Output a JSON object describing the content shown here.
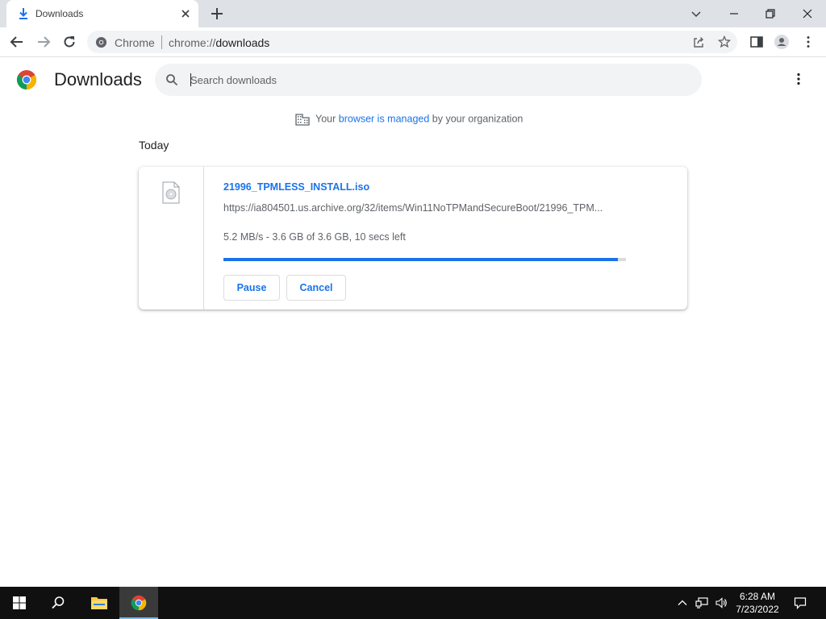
{
  "tab": {
    "title": "Downloads"
  },
  "omnibox": {
    "chip": "Chrome",
    "url_scheme": "chrome://",
    "url_host": "downloads"
  },
  "page": {
    "title": "Downloads",
    "search_placeholder": "Search downloads",
    "managed_prefix": "Your",
    "managed_link": "browser is managed",
    "managed_suffix": "by your organization",
    "date_header": "Today"
  },
  "download": {
    "file_name": "21996_TPMLESS_INSTALL.iso",
    "url": "https://ia804501.us.archive.org/32/items/Win11NoTPMandSecureBoot/21996_TPM...",
    "status": "5.2 MB/s - 3.6 GB of 3.6 GB, 10 secs left",
    "progress_fraction": 0.98,
    "pause_label": "Pause",
    "cancel_label": "Cancel"
  },
  "taskbar": {
    "time": "6:28 AM",
    "date": "7/23/2022"
  },
  "colors": {
    "accent": "#1a73e8",
    "tab_strip": "#dee1e6",
    "taskbar": "#101010"
  }
}
